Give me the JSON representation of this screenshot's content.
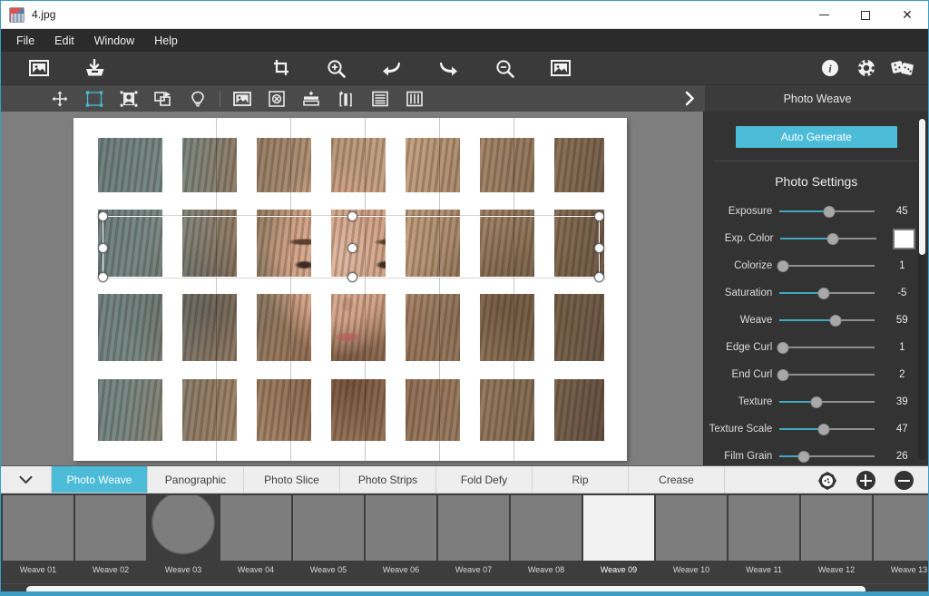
{
  "window": {
    "title": "4.jpg",
    "app_icon": "image-file-icon",
    "controls": {
      "minimize": "minimize-icon",
      "maximize": "maximize-icon",
      "close": "close-icon"
    }
  },
  "menubar": {
    "items": [
      "File",
      "Edit",
      "Window",
      "Help"
    ]
  },
  "toolbar_main": {
    "left_buttons": [
      {
        "name": "open-image-icon",
        "tooltip": "Open Image"
      },
      {
        "name": "save-image-icon",
        "tooltip": "Save Image"
      }
    ],
    "center_buttons": [
      {
        "name": "crop-icon",
        "tooltip": "Crop"
      },
      {
        "name": "zoom-in-icon",
        "tooltip": "Zoom In"
      },
      {
        "name": "undo-icon",
        "tooltip": "Undo"
      },
      {
        "name": "redo-icon",
        "tooltip": "Redo"
      },
      {
        "name": "zoom-out-icon",
        "tooltip": "Zoom Out"
      },
      {
        "name": "fit-image-icon",
        "tooltip": "Fit Image"
      }
    ],
    "right_buttons": [
      {
        "name": "info-icon",
        "tooltip": "Info"
      },
      {
        "name": "settings-gear-icon",
        "tooltip": "Settings"
      },
      {
        "name": "randomize-dice-icon",
        "tooltip": "Randomize"
      }
    ]
  },
  "toolbar_secondary": {
    "buttons": [
      {
        "name": "move-tool-icon",
        "active": false
      },
      {
        "name": "select-rectangle-tool-icon",
        "active": true
      },
      {
        "name": "portrait-frame-tool-icon",
        "active": false
      },
      {
        "name": "duplicate-shape-tool-icon",
        "active": false
      },
      {
        "name": "light-bulb-tool-icon",
        "active": false
      },
      {
        "name": "image-layer-icon",
        "active": false
      },
      {
        "name": "delete-mask-icon",
        "active": false
      },
      {
        "name": "add-horizontal-strip-icon",
        "active": false
      },
      {
        "name": "add-vertical-strip-icon",
        "active": false
      },
      {
        "name": "horizontal-lines-icon",
        "active": false
      },
      {
        "name": "vertical-lines-icon",
        "active": false
      }
    ],
    "expand_icon": "chevron-right-icon",
    "panel_header": "Photo Weave"
  },
  "right_panel": {
    "auto_generate_label": "Auto Generate",
    "section_title": "Photo Settings",
    "settings": [
      {
        "label": "Exposure",
        "value": "45",
        "percent": 52,
        "fill": 52,
        "control": "slider"
      },
      {
        "label": "Exp. Color",
        "value": "",
        "percent": 54,
        "fill": 54,
        "control": "slider-with-swatch",
        "swatch_color": "#ffffff"
      },
      {
        "label": "Colorize",
        "value": "1",
        "percent": 4,
        "fill": 0,
        "control": "slider"
      },
      {
        "label": "Saturation",
        "value": "-5",
        "percent": 47,
        "fill": 47,
        "control": "slider"
      },
      {
        "label": "Weave",
        "value": "59",
        "percent": 59,
        "fill": 59,
        "control": "slider"
      },
      {
        "label": "Edge Curl",
        "value": "1",
        "percent": 4,
        "fill": 0,
        "control": "slider"
      },
      {
        "label": "End Curl",
        "value": "2",
        "percent": 4,
        "fill": 0,
        "control": "slider"
      },
      {
        "label": "Texture",
        "value": "39",
        "percent": 39,
        "fill": 39,
        "control": "slider"
      },
      {
        "label": "Texture Scale",
        "value": "47",
        "percent": 47,
        "fill": 47,
        "control": "slider"
      },
      {
        "label": "Film Grain",
        "value": "26",
        "percent": 26,
        "fill": 26,
        "control": "slider"
      }
    ],
    "accent_color": "#4cbcd8",
    "slider_fill_color": "#3fa9bf"
  },
  "effect_tabs": {
    "collapse_icon": "chevron-down-icon",
    "tabs": [
      {
        "label": "Photo Weave",
        "active": true
      },
      {
        "label": "Panographic",
        "active": false
      },
      {
        "label": "Photo Slice",
        "active": false
      },
      {
        "label": "Photo Strips",
        "active": false
      },
      {
        "label": "Fold Defy",
        "active": false
      },
      {
        "label": "Rip",
        "active": false
      },
      {
        "label": "Crease",
        "active": false
      }
    ],
    "tools": [
      {
        "name": "preset-options-icon"
      },
      {
        "name": "add-preset-icon"
      },
      {
        "name": "remove-preset-icon"
      }
    ]
  },
  "presets": {
    "items": [
      {
        "label": "Weave 01",
        "pattern": "p1",
        "selected": false
      },
      {
        "label": "Weave 02",
        "pattern": "p2",
        "selected": false
      },
      {
        "label": "Weave 03",
        "pattern": "p3",
        "selected": false
      },
      {
        "label": "Weave 04",
        "pattern": "p4",
        "selected": false
      },
      {
        "label": "Weave 05",
        "pattern": "p5",
        "selected": false
      },
      {
        "label": "Weave 06",
        "pattern": "p6",
        "selected": false
      },
      {
        "label": "Weave 07",
        "pattern": "p7",
        "selected": false
      },
      {
        "label": "Weave 08",
        "pattern": "p8",
        "selected": false
      },
      {
        "label": "Weave 09",
        "pattern": "p9",
        "selected": true
      },
      {
        "label": "Weave 10",
        "pattern": "p10",
        "selected": false
      },
      {
        "label": "Weave 11",
        "pattern": "p11",
        "selected": false
      },
      {
        "label": "Weave 12",
        "pattern": "p12",
        "selected": false
      },
      {
        "label": "Weave 13",
        "pattern": "p13",
        "selected": false
      }
    ]
  },
  "canvas": {
    "document_name": "4.jpg",
    "selection": {
      "handles": 9,
      "state": "active"
    },
    "background_color": "#7e7e7e",
    "paper_color": "#ffffff"
  }
}
